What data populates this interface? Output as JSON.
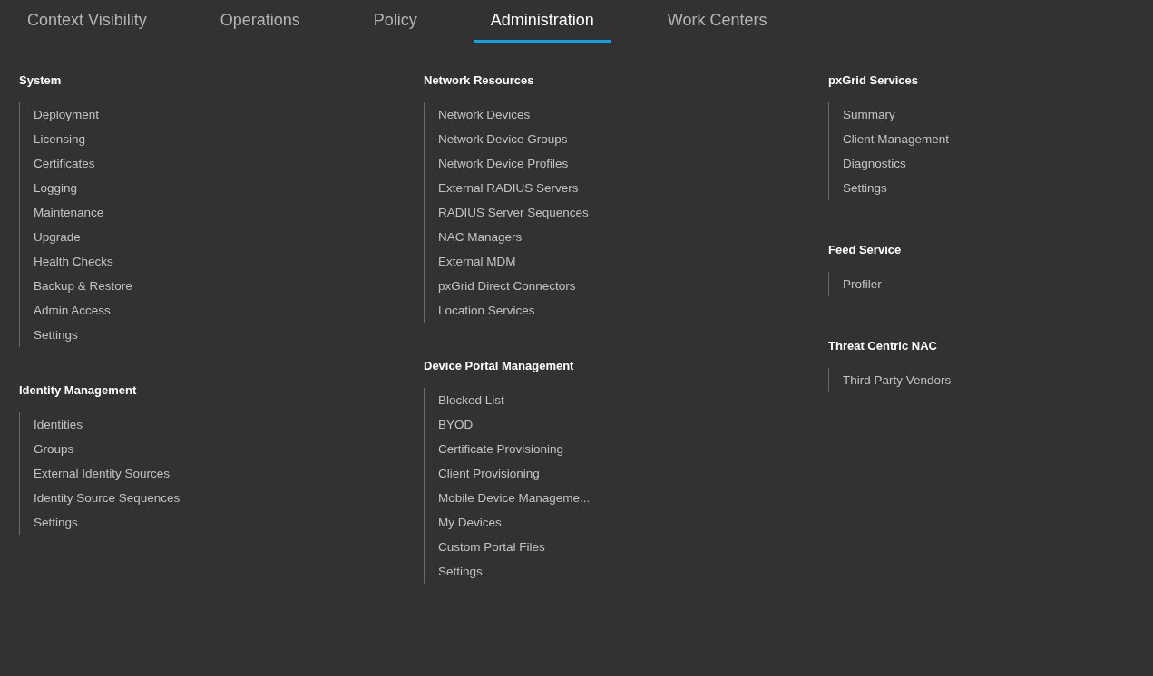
{
  "tabs": [
    {
      "label": "Context Visibility",
      "selected": false
    },
    {
      "label": "Operations",
      "selected": false
    },
    {
      "label": "Policy",
      "selected": false
    },
    {
      "label": "Administration",
      "selected": true
    },
    {
      "label": "Work Centers",
      "selected": false
    }
  ],
  "columns": [
    {
      "sections": [
        {
          "title": "System",
          "items": [
            "Deployment",
            "Licensing",
            "Certificates",
            "Logging",
            "Maintenance",
            "Upgrade",
            "Health Checks",
            "Backup & Restore",
            "Admin Access",
            "Settings"
          ]
        },
        {
          "title": "Identity Management",
          "items": [
            "Identities",
            "Groups",
            "External Identity Sources",
            "Identity Source Sequences",
            "Settings"
          ]
        }
      ]
    },
    {
      "sections": [
        {
          "title": "Network Resources",
          "items": [
            "Network Devices",
            "Network Device Groups",
            "Network Device Profiles",
            "External RADIUS Servers",
            "RADIUS Server Sequences",
            "NAC Managers",
            "External MDM",
            "pxGrid Direct Connectors",
            "Location Services"
          ]
        },
        {
          "title": "Device Portal Management",
          "items": [
            "Blocked List",
            "BYOD",
            "Certificate Provisioning",
            "Client Provisioning",
            "Mobile Device Manageme...",
            "My Devices",
            "Custom Portal Files",
            "Settings"
          ]
        }
      ]
    },
    {
      "sections": [
        {
          "title": "pxGrid Services",
          "items": [
            "Summary",
            "Client Management",
            "Diagnostics",
            "Settings"
          ]
        },
        {
          "title": "Feed Service",
          "items": [
            "Profiler"
          ]
        },
        {
          "title": "Threat Centric NAC",
          "items": [
            "Third Party Vendors"
          ]
        }
      ]
    }
  ]
}
